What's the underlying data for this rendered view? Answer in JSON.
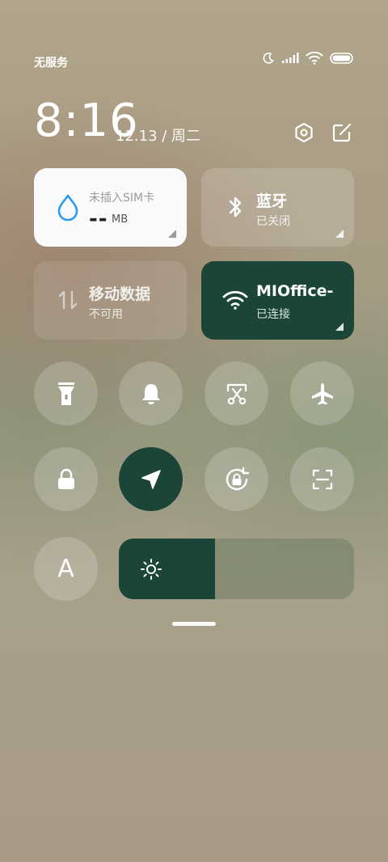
{
  "status_bar": {
    "carrier": "无服务",
    "icons": [
      "moon-icon",
      "signal-icon",
      "wifi-icon",
      "battery-icon"
    ]
  },
  "header": {
    "time": "8:16",
    "date": "12.13 / 周二",
    "icons": [
      "settings-icon",
      "edit-icon"
    ]
  },
  "tiles": {
    "sim": {
      "title": "未插入SIM卡",
      "usage": "--",
      "unit": "MB",
      "icon": "water-drop-icon",
      "accent": "#2a9bf2"
    },
    "bluetooth": {
      "title": "蓝牙",
      "status": "已关闭",
      "icon": "bluetooth-icon"
    },
    "mobile_data": {
      "title": "移动数据",
      "status": "不可用",
      "icon": "data-arrows-icon"
    },
    "wifi": {
      "title": "MIOffice-",
      "status": "已连接",
      "icon": "wifi-icon"
    }
  },
  "toggles": [
    {
      "name": "flashlight",
      "icon": "flashlight-icon",
      "active": false
    },
    {
      "name": "bell",
      "icon": "bell-icon",
      "active": false
    },
    {
      "name": "screenshot",
      "icon": "scissors-icon",
      "active": false
    },
    {
      "name": "airplane",
      "icon": "airplane-icon",
      "active": false
    },
    {
      "name": "lock",
      "icon": "lock-icon",
      "active": false
    },
    {
      "name": "location",
      "icon": "location-arrow-icon",
      "active": true
    },
    {
      "name": "rotation-lock",
      "icon": "rotation-lock-icon",
      "active": false
    },
    {
      "name": "scanner",
      "icon": "scan-icon",
      "active": false
    }
  ],
  "font_toggle": {
    "label": "A"
  },
  "brightness": {
    "level": 0.41,
    "icon": "sun-icon"
  },
  "colors": {
    "accent": "#1b4637",
    "tile_light": "#fafafa"
  }
}
